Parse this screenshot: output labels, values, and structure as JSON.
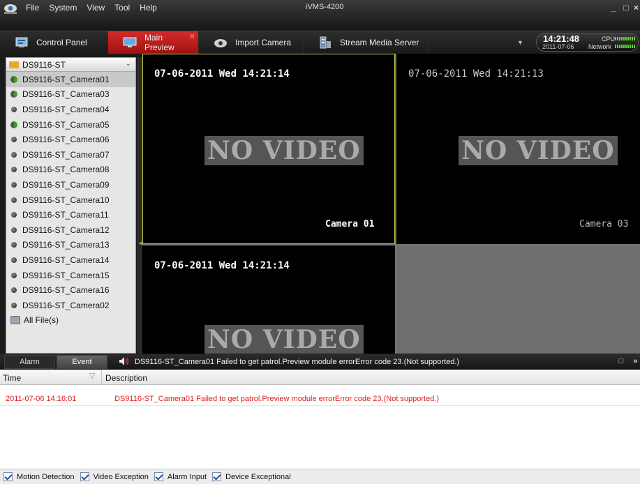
{
  "app": {
    "title": "iVMS-4200",
    "menu": [
      "File",
      "System",
      "View",
      "Tool",
      "Help"
    ]
  },
  "tabs": [
    {
      "label": "Control Panel",
      "icon": "control-panel-icon"
    },
    {
      "label": "Main Preview",
      "icon": "monitor-icon",
      "active": true
    },
    {
      "label": "Import Camera",
      "icon": "camera-icon"
    },
    {
      "label": "Stream Media Server",
      "icon": "server-icon"
    }
  ],
  "status": {
    "time": "14:21:48",
    "date": "2011-07-06",
    "cpu_label": "CPU",
    "network_label": "Network"
  },
  "tree": {
    "root": "DS9116-ST",
    "items": [
      {
        "label": "DS9116-ST_Camera01",
        "state": "mixed",
        "selected": true
      },
      {
        "label": "DS9116-ST_Camera03",
        "state": "mixed"
      },
      {
        "label": "DS9116-ST_Camera04",
        "state": "gray"
      },
      {
        "label": "DS9116-ST_Camera05",
        "state": "mixed"
      },
      {
        "label": "DS9116-ST_Camera06",
        "state": "gray"
      },
      {
        "label": "DS9116-ST_Camera07",
        "state": "gray"
      },
      {
        "label": "DS9116-ST_Camera08",
        "state": "gray"
      },
      {
        "label": "DS9116-ST_Camera09",
        "state": "gray"
      },
      {
        "label": "DS9116-ST_Camera10",
        "state": "gray"
      },
      {
        "label": "DS9116-ST_Camera11",
        "state": "gray"
      },
      {
        "label": "DS9116-ST_Camera12",
        "state": "gray"
      },
      {
        "label": "DS9116-ST_Camera13",
        "state": "gray"
      },
      {
        "label": "DS9116-ST_Camera14",
        "state": "gray"
      },
      {
        "label": "DS9116-ST_Camera15",
        "state": "gray"
      },
      {
        "label": "DS9116-ST_Camera16",
        "state": "gray"
      },
      {
        "label": "DS9116-ST_Camera02",
        "state": "gray"
      }
    ],
    "all_files": "All File(s)"
  },
  "panes": [
    {
      "osd": "07-06-2011 Wed 14:21:14",
      "no_video": "NO VIDEO",
      "camera": "Camera 01"
    },
    {
      "osd": "07-06-2011 Wed 14:21:13",
      "no_video": "NO VIDEO",
      "camera": "Camera 03"
    },
    {
      "osd": "07-06-2011 Wed 14:21:14",
      "no_video": "NO VIDEO"
    }
  ],
  "events": {
    "tabs": [
      "Alarm",
      "Event"
    ],
    "message": "DS9116-ST_Camera01 Failed to get patrol.Preview module errorError code 23.(Not supported.)",
    "columns": {
      "time": "Time",
      "description": "Description"
    },
    "rows": [
      {
        "time": "2011-07-06 14:16:01",
        "description": "DS9116-ST_Camera01 Failed to get patrol.Preview module errorError code 23.(Not supported.)"
      }
    ],
    "filters": [
      "Motion Detection",
      "Video Exception",
      "Alarm Input",
      "Device Exceptional"
    ]
  },
  "colors": {
    "accent": "#c41e1e",
    "error_text": "#e02020",
    "meter": "#5cd62a",
    "focus_border": "#c9c94a"
  }
}
